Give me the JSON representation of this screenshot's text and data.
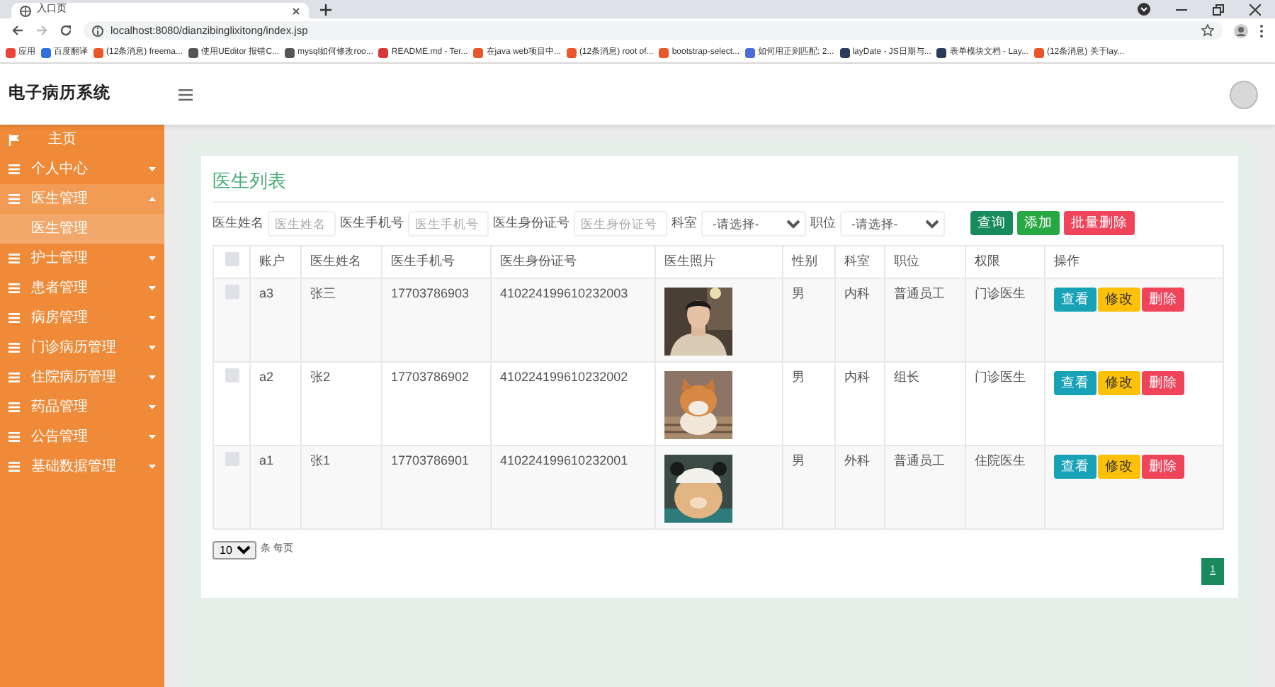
{
  "browser": {
    "tab": {
      "title": "入口页"
    },
    "url": "localhost:8080/dianzibinglixitong/index.jsp",
    "bookmarks": [
      {
        "label": "应用",
        "color": "#e8453c"
      },
      {
        "label": "百度翻译",
        "color": "#2f6fe0"
      },
      {
        "label": "(12条消息) freema...",
        "color": "#e8562a"
      },
      {
        "label": "使用UEditor 报错C...",
        "color": "#555555"
      },
      {
        "label": "mysql如何修改roo...",
        "color": "#555555"
      },
      {
        "label": "README.md - Ter...",
        "color": "#d9383a"
      },
      {
        "label": "在java web项目中...",
        "color": "#e8562a"
      },
      {
        "label": "(12条消息) root of...",
        "color": "#e8562a"
      },
      {
        "label": "bootstrap-select...",
        "color": "#e8562a"
      },
      {
        "label": "如何用正则匹配: 2...",
        "color": "#4a6bd8"
      },
      {
        "label": "layDate - JS日期与...",
        "color": "#2a3a5a"
      },
      {
        "label": "表单模块文档 - Lay...",
        "color": "#2a3a5a"
      },
      {
        "label": "(12条消息) 关于lay...",
        "color": "#e8562a"
      }
    ]
  },
  "app": {
    "title": "电子病历系统"
  },
  "sidebar": {
    "items": [
      {
        "label": "主页",
        "kind": "link"
      },
      {
        "label": "个人中心",
        "kind": "menu",
        "expanded": false
      },
      {
        "label": "医生管理",
        "kind": "menu",
        "expanded": true,
        "children": [
          {
            "label": "医生管理",
            "selected": true
          }
        ]
      },
      {
        "label": "护士管理",
        "kind": "menu",
        "expanded": false
      },
      {
        "label": "患者管理",
        "kind": "menu",
        "expanded": false
      },
      {
        "label": "病房管理",
        "kind": "menu",
        "expanded": false
      },
      {
        "label": "门诊病历管理",
        "kind": "menu",
        "expanded": false
      },
      {
        "label": "住院病历管理",
        "kind": "menu",
        "expanded": false
      },
      {
        "label": "药品管理",
        "kind": "menu",
        "expanded": false
      },
      {
        "label": "公告管理",
        "kind": "menu",
        "expanded": false
      },
      {
        "label": "基础数据管理",
        "kind": "menu",
        "expanded": false
      }
    ]
  },
  "page": {
    "title": "医生列表",
    "filters": [
      {
        "kind": "text",
        "label": "医生姓名",
        "placeholder": "医生姓名"
      },
      {
        "kind": "text",
        "label": "医生手机号",
        "placeholder": "医生手机号"
      },
      {
        "kind": "text",
        "label": "医生身份证号",
        "placeholder": "医生身份证号"
      },
      {
        "kind": "select",
        "label": "科室",
        "value": "-请选择-"
      },
      {
        "kind": "select",
        "label": "职位",
        "value": "-请选择-"
      }
    ],
    "buttons": [
      {
        "label": "查询",
        "kind": "search"
      },
      {
        "label": "添加",
        "kind": "add"
      },
      {
        "label": "批量删除",
        "kind": "delete"
      }
    ],
    "table": {
      "select_all": false,
      "columns": [
        "账户",
        "医生姓名",
        "医生手机号",
        "医生身份证号",
        "医生照片",
        "性别",
        "科室",
        "职位",
        "权限",
        "操作"
      ],
      "rows": [
        {
          "checked": false,
          "account": "a3",
          "name": "张三",
          "phone": "17703786903",
          "id_number": "410224199610232003",
          "gender": "男",
          "department": "内科",
          "position": "普通员工",
          "permission": "门诊医生",
          "actions": [
            {
              "label": "查看",
              "kind": "view"
            },
            {
              "label": "修改",
              "kind": "edit"
            },
            {
              "label": "删除",
              "kind": "delete"
            }
          ]
        },
        {
          "checked": false,
          "account": "a2",
          "name": "张2",
          "phone": "17703786902",
          "id_number": "410224199610232002",
          "gender": "男",
          "department": "内科",
          "position": "组长",
          "permission": "门诊医生",
          "actions": [
            {
              "label": "查看",
              "kind": "view"
            },
            {
              "label": "修改",
              "kind": "edit"
            },
            {
              "label": "删除",
              "kind": "delete"
            }
          ]
        },
        {
          "checked": false,
          "account": "a1",
          "name": "张1",
          "phone": "17703786901",
          "id_number": "410224199610232001",
          "gender": "男",
          "department": "外科",
          "position": "普通员工",
          "permission": "住院医生",
          "actions": [
            {
              "label": "查看",
              "kind": "view"
            },
            {
              "label": "修改",
              "kind": "edit"
            },
            {
              "label": "删除",
              "kind": "delete"
            }
          ]
        }
      ]
    },
    "pagination": {
      "page_size": "10",
      "page_size_label": "条 每页",
      "pages": [
        {
          "label": "1",
          "selected": true
        }
      ]
    }
  }
}
